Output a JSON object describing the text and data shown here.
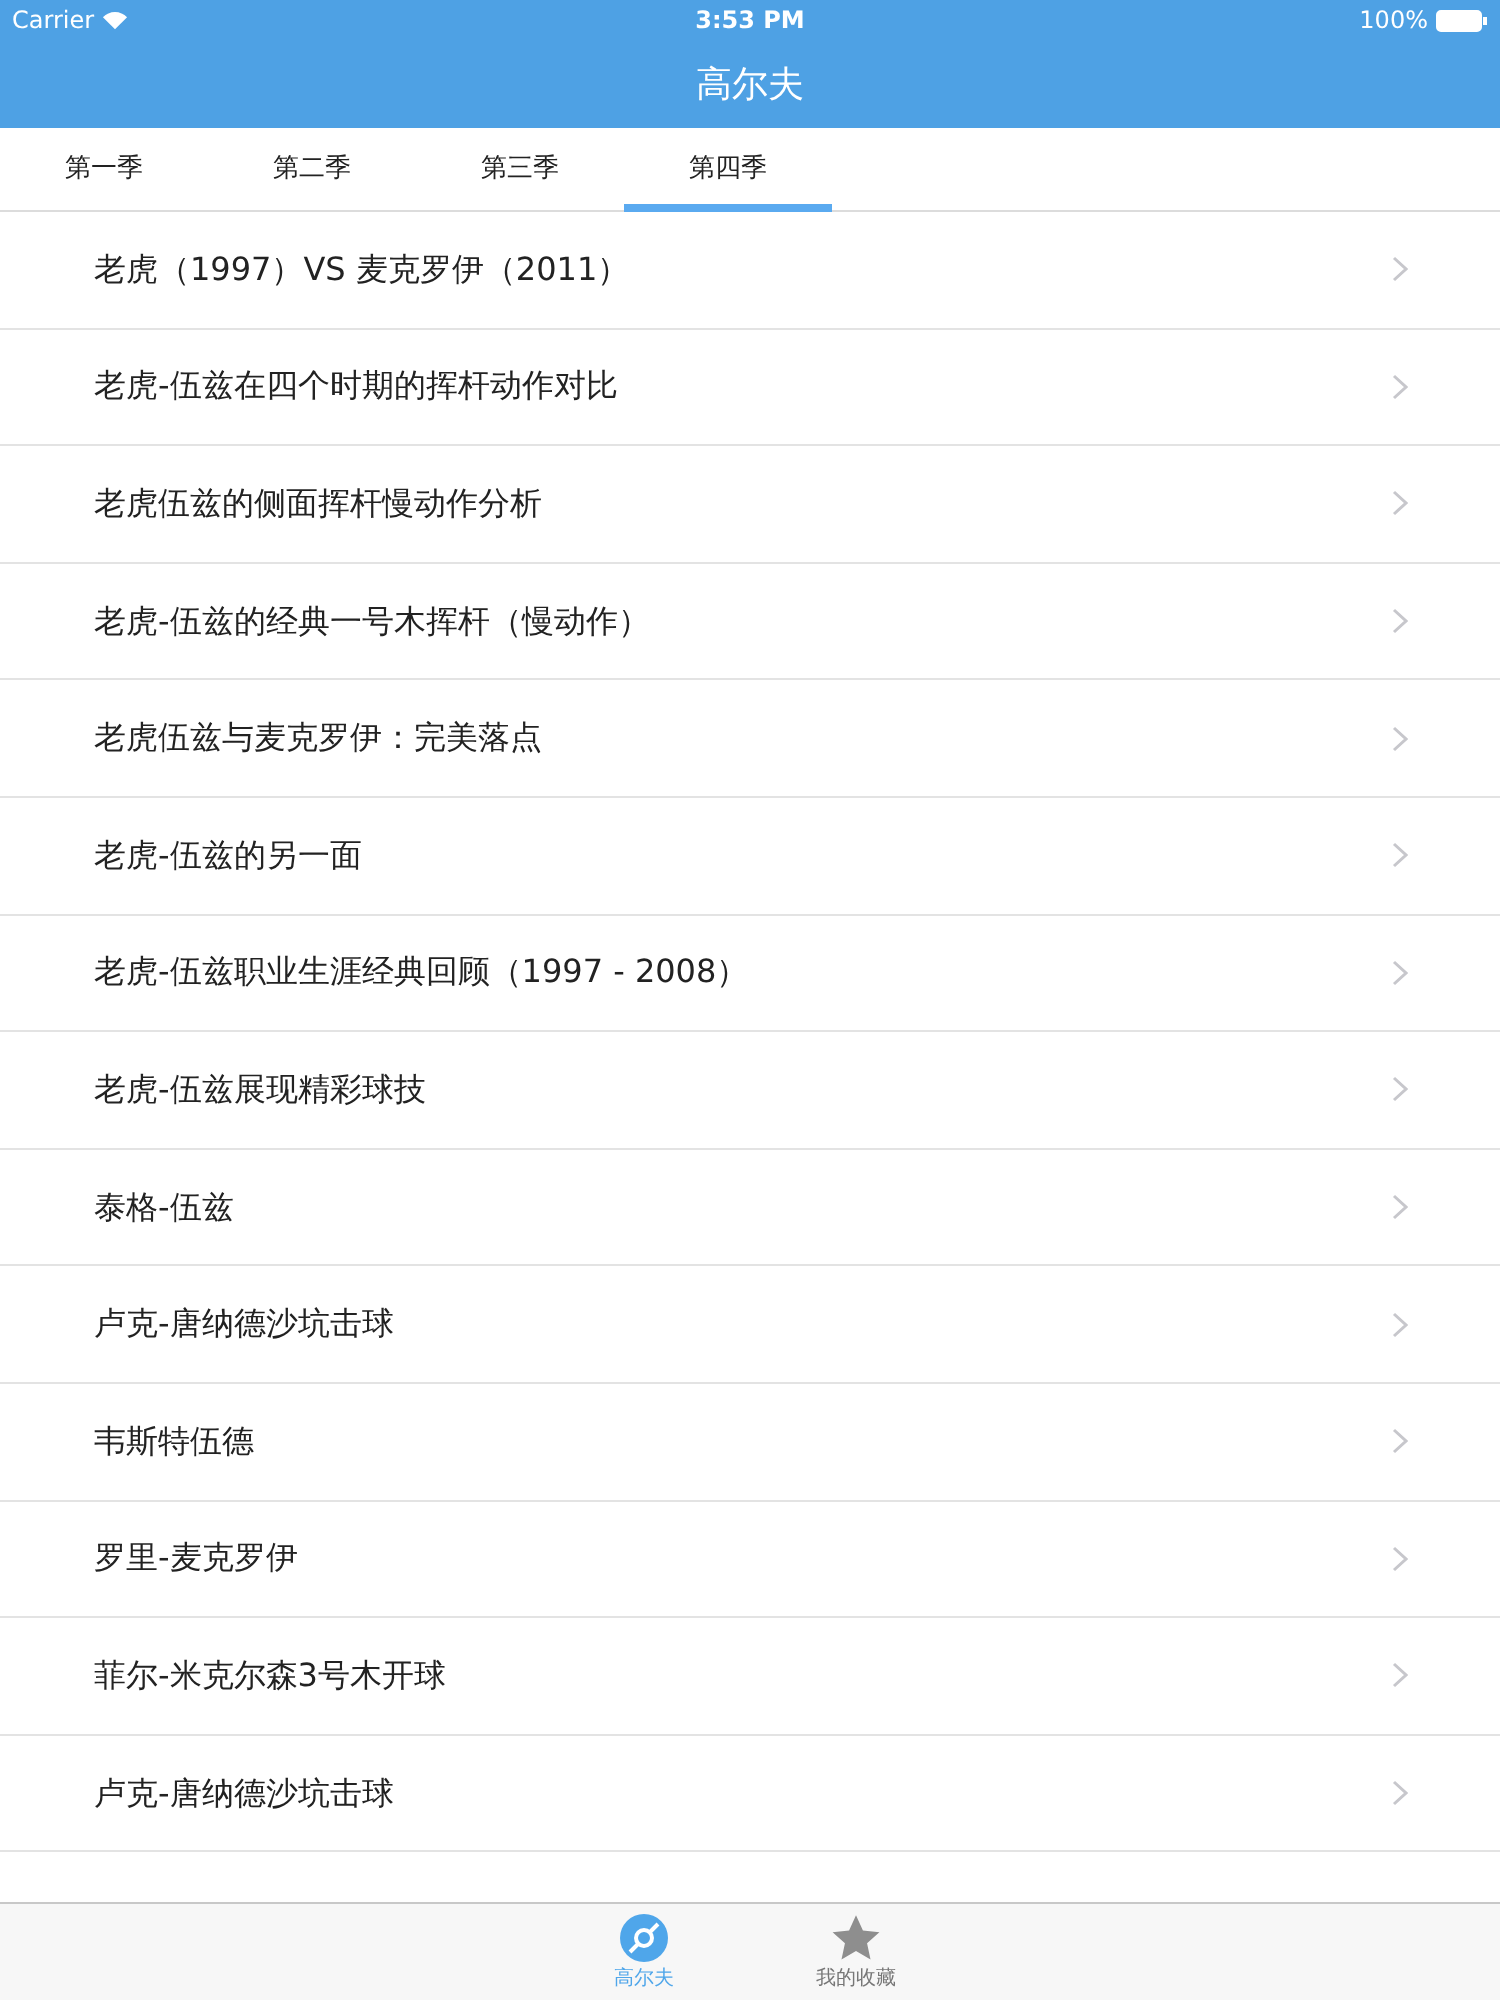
{
  "status_bar": {
    "carrier": "Carrier",
    "time": "3:53 PM",
    "battery": "100%"
  },
  "nav": {
    "title": "高尔夫"
  },
  "tabs": [
    {
      "label": "第一季",
      "selected": false
    },
    {
      "label": "第二季",
      "selected": false
    },
    {
      "label": "第三季",
      "selected": false
    },
    {
      "label": "第四季",
      "selected": true
    }
  ],
  "rows": [
    "老虎（1997）VS 麦克罗伊（2011）",
    "老虎-伍兹在四个时期的挥杆动作对比",
    "老虎伍兹的侧面挥杆慢动作分析",
    "老虎-伍兹的经典一号木挥杆（慢动作）",
    "老虎伍兹与麦克罗伊：完美落点",
    "老虎-伍兹的另一面",
    "老虎-伍兹职业生涯经典回顾（1997 - 2008）",
    "老虎-伍兹展现精彩球技",
    "泰格-伍兹",
    "卢克-唐纳德沙坑击球",
    "韦斯特伍德",
    "罗里-麦克罗伊",
    "菲尔-米克尔森3号木开球",
    "卢克-唐纳德沙坑击球"
  ],
  "tab_bar": [
    {
      "label": "高尔夫",
      "kind": "disc",
      "selected": true
    },
    {
      "label": "我的收藏",
      "kind": "star",
      "selected": false
    }
  ]
}
